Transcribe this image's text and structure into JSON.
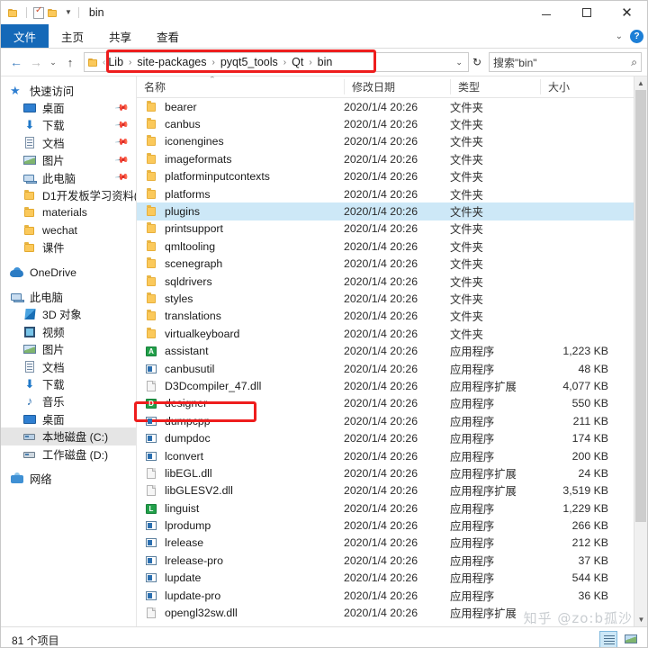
{
  "window": {
    "title": "bin",
    "quick_access": [
      "folder-icon",
      "properties-icon",
      "new-folder-icon",
      "customize-caret"
    ],
    "controls": {
      "minimize": "—",
      "maximize": "▢",
      "close": "✕"
    }
  },
  "ribbon": {
    "tabs": [
      {
        "label": "文件",
        "active": true
      },
      {
        "label": "主页",
        "active": false
      },
      {
        "label": "共享",
        "active": false
      },
      {
        "label": "查看",
        "active": false
      }
    ],
    "collapse_caret": "⌄",
    "help_label": "?"
  },
  "address_bar": {
    "back": "←",
    "forward": "→",
    "recent_caret": "⌄",
    "up": "↑",
    "breadcrumbs": [
      "Lib",
      "site-packages",
      "pyqt5_tools",
      "Qt",
      "bin"
    ],
    "separator": "›",
    "dropdown_caret": "⌄",
    "refresh": "↻",
    "search_placeholder": "搜索\"bin\"",
    "search_value": "",
    "search_icon": "search-icon"
  },
  "sidebar": {
    "items": [
      {
        "label": "快速访问",
        "icon": "star-icon",
        "indent": 0,
        "pinned": false,
        "selected": false
      },
      {
        "label": "桌面",
        "icon": "desktop-icon",
        "indent": 1,
        "pinned": true,
        "selected": false
      },
      {
        "label": "下载",
        "icon": "download-icon",
        "indent": 1,
        "pinned": true,
        "selected": false
      },
      {
        "label": "文档",
        "icon": "documents-icon",
        "indent": 1,
        "pinned": true,
        "selected": false
      },
      {
        "label": "图片",
        "icon": "pictures-icon",
        "indent": 1,
        "pinned": true,
        "selected": false
      },
      {
        "label": "此电脑",
        "icon": "this-pc-icon",
        "indent": 1,
        "pinned": true,
        "selected": false
      },
      {
        "label": "D1开发板学习资料(",
        "icon": "folder-icon",
        "indent": 1,
        "pinned": false,
        "selected": false
      },
      {
        "label": "materials",
        "icon": "folder-icon",
        "indent": 1,
        "pinned": false,
        "selected": false
      },
      {
        "label": "wechat",
        "icon": "folder-icon",
        "indent": 1,
        "pinned": false,
        "selected": false
      },
      {
        "label": "课件",
        "icon": "folder-icon",
        "indent": 1,
        "pinned": false,
        "selected": false
      },
      {
        "label": "OneDrive",
        "icon": "onedrive-icon",
        "indent": 0,
        "pinned": false,
        "selected": false
      },
      {
        "label": "此电脑",
        "icon": "this-pc-icon",
        "indent": 0,
        "pinned": false,
        "selected": false
      },
      {
        "label": "3D 对象",
        "icon": "3d-objects-icon",
        "indent": 1,
        "pinned": false,
        "selected": false
      },
      {
        "label": "视频",
        "icon": "videos-icon",
        "indent": 1,
        "pinned": false,
        "selected": false
      },
      {
        "label": "图片",
        "icon": "pictures-icon",
        "indent": 1,
        "pinned": false,
        "selected": false
      },
      {
        "label": "文档",
        "icon": "documents-icon",
        "indent": 1,
        "pinned": false,
        "selected": false
      },
      {
        "label": "下载",
        "icon": "download-icon",
        "indent": 1,
        "pinned": false,
        "selected": false
      },
      {
        "label": "音乐",
        "icon": "music-icon",
        "indent": 1,
        "pinned": false,
        "selected": false
      },
      {
        "label": "桌面",
        "icon": "desktop-icon",
        "indent": 1,
        "pinned": false,
        "selected": false
      },
      {
        "label": "本地磁盘 (C:)",
        "icon": "system-drive-icon",
        "indent": 1,
        "pinned": false,
        "selected": true
      },
      {
        "label": "工作磁盘 (D:)",
        "icon": "drive-icon",
        "indent": 1,
        "pinned": false,
        "selected": false
      },
      {
        "label": "网络",
        "icon": "network-icon",
        "indent": 0,
        "pinned": false,
        "selected": false
      }
    ]
  },
  "file_list": {
    "columns": [
      {
        "label": "名称",
        "key": "name"
      },
      {
        "label": "修改日期",
        "key": "date"
      },
      {
        "label": "类型",
        "key": "type"
      },
      {
        "label": "大小",
        "key": "size"
      }
    ],
    "sort_indicator": "⌃",
    "rows": [
      {
        "name": "bearer",
        "date": "2020/1/4 20:26",
        "type": "文件夹",
        "size": "",
        "icon": "folder-icon",
        "selected": false
      },
      {
        "name": "canbus",
        "date": "2020/1/4 20:26",
        "type": "文件夹",
        "size": "",
        "icon": "folder-icon",
        "selected": false
      },
      {
        "name": "iconengines",
        "date": "2020/1/4 20:26",
        "type": "文件夹",
        "size": "",
        "icon": "folder-icon",
        "selected": false
      },
      {
        "name": "imageformats",
        "date": "2020/1/4 20:26",
        "type": "文件夹",
        "size": "",
        "icon": "folder-icon",
        "selected": false
      },
      {
        "name": "platforminputcontexts",
        "date": "2020/1/4 20:26",
        "type": "文件夹",
        "size": "",
        "icon": "folder-icon",
        "selected": false
      },
      {
        "name": "platforms",
        "date": "2020/1/4 20:26",
        "type": "文件夹",
        "size": "",
        "icon": "folder-icon",
        "selected": false
      },
      {
        "name": "plugins",
        "date": "2020/1/4 20:26",
        "type": "文件夹",
        "size": "",
        "icon": "folder-icon",
        "selected": true
      },
      {
        "name": "printsupport",
        "date": "2020/1/4 20:26",
        "type": "文件夹",
        "size": "",
        "icon": "folder-icon",
        "selected": false
      },
      {
        "name": "qmltooling",
        "date": "2020/1/4 20:26",
        "type": "文件夹",
        "size": "",
        "icon": "folder-icon",
        "selected": false
      },
      {
        "name": "scenegraph",
        "date": "2020/1/4 20:26",
        "type": "文件夹",
        "size": "",
        "icon": "folder-icon",
        "selected": false
      },
      {
        "name": "sqldrivers",
        "date": "2020/1/4 20:26",
        "type": "文件夹",
        "size": "",
        "icon": "folder-icon",
        "selected": false
      },
      {
        "name": "styles",
        "date": "2020/1/4 20:26",
        "type": "文件夹",
        "size": "",
        "icon": "folder-icon",
        "selected": false
      },
      {
        "name": "translations",
        "date": "2020/1/4 20:26",
        "type": "文件夹",
        "size": "",
        "icon": "folder-icon",
        "selected": false
      },
      {
        "name": "virtualkeyboard",
        "date": "2020/1/4 20:26",
        "type": "文件夹",
        "size": "",
        "icon": "folder-icon",
        "selected": false
      },
      {
        "name": "assistant",
        "date": "2020/1/4 20:26",
        "type": "应用程序",
        "size": "1,223 KB",
        "icon": "assistant-app-icon",
        "selected": false
      },
      {
        "name": "canbusutil",
        "date": "2020/1/4 20:26",
        "type": "应用程序",
        "size": "48 KB",
        "icon": "exe-icon",
        "selected": false
      },
      {
        "name": "D3Dcompiler_47.dll",
        "date": "2020/1/4 20:26",
        "type": "应用程序扩展",
        "size": "4,077 KB",
        "icon": "dll-icon",
        "selected": false
      },
      {
        "name": "designer",
        "date": "2020/1/4 20:26",
        "type": "应用程序",
        "size": "550 KB",
        "icon": "designer-app-icon",
        "selected": false
      },
      {
        "name": "dumpcpp",
        "date": "2020/1/4 20:26",
        "type": "应用程序",
        "size": "211 KB",
        "icon": "exe-icon",
        "selected": false
      },
      {
        "name": "dumpdoc",
        "date": "2020/1/4 20:26",
        "type": "应用程序",
        "size": "174 KB",
        "icon": "exe-icon",
        "selected": false
      },
      {
        "name": "lconvert",
        "date": "2020/1/4 20:26",
        "type": "应用程序",
        "size": "200 KB",
        "icon": "exe-icon",
        "selected": false
      },
      {
        "name": "libEGL.dll",
        "date": "2020/1/4 20:26",
        "type": "应用程序扩展",
        "size": "24 KB",
        "icon": "dll-icon",
        "selected": false
      },
      {
        "name": "libGLESV2.dll",
        "date": "2020/1/4 20:26",
        "type": "应用程序扩展",
        "size": "3,519 KB",
        "icon": "dll-icon",
        "selected": false
      },
      {
        "name": "linguist",
        "date": "2020/1/4 20:26",
        "type": "应用程序",
        "size": "1,229 KB",
        "icon": "linguist-app-icon",
        "selected": false
      },
      {
        "name": "lprodump",
        "date": "2020/1/4 20:26",
        "type": "应用程序",
        "size": "266 KB",
        "icon": "exe-icon",
        "selected": false
      },
      {
        "name": "lrelease",
        "date": "2020/1/4 20:26",
        "type": "应用程序",
        "size": "212 KB",
        "icon": "exe-icon",
        "selected": false
      },
      {
        "name": "lrelease-pro",
        "date": "2020/1/4 20:26",
        "type": "应用程序",
        "size": "37 KB",
        "icon": "exe-icon",
        "selected": false
      },
      {
        "name": "lupdate",
        "date": "2020/1/4 20:26",
        "type": "应用程序",
        "size": "544 KB",
        "icon": "exe-icon",
        "selected": false
      },
      {
        "name": "lupdate-pro",
        "date": "2020/1/4 20:26",
        "type": "应用程序",
        "size": "36 KB",
        "icon": "exe-icon",
        "selected": false
      },
      {
        "name": "opengl32sw.dll",
        "date": "2020/1/4 20:26",
        "type": "应用程序扩展",
        "size": "",
        "icon": "dll-icon",
        "selected": false
      }
    ]
  },
  "status_bar": {
    "item_count": "81 个项目",
    "views": [
      {
        "name": "details-view",
        "active": true
      },
      {
        "name": "large-icons-view",
        "active": false
      }
    ]
  },
  "annotations": {
    "highlight_color": "#ee1d1d",
    "boxes": [
      {
        "target": "address-bar-breadcrumbs"
      },
      {
        "target": "file-row-designer"
      }
    ]
  },
  "watermark": {
    "text": "知乎 @zo:b孤沙"
  },
  "colors": {
    "accent_blue": "#1569b8",
    "selection_blue": "#cde8f7",
    "sidebar_selection": "#e5e5e5",
    "annotation_red": "#ee1d1d",
    "folder_yellow": "#fbc95b"
  }
}
